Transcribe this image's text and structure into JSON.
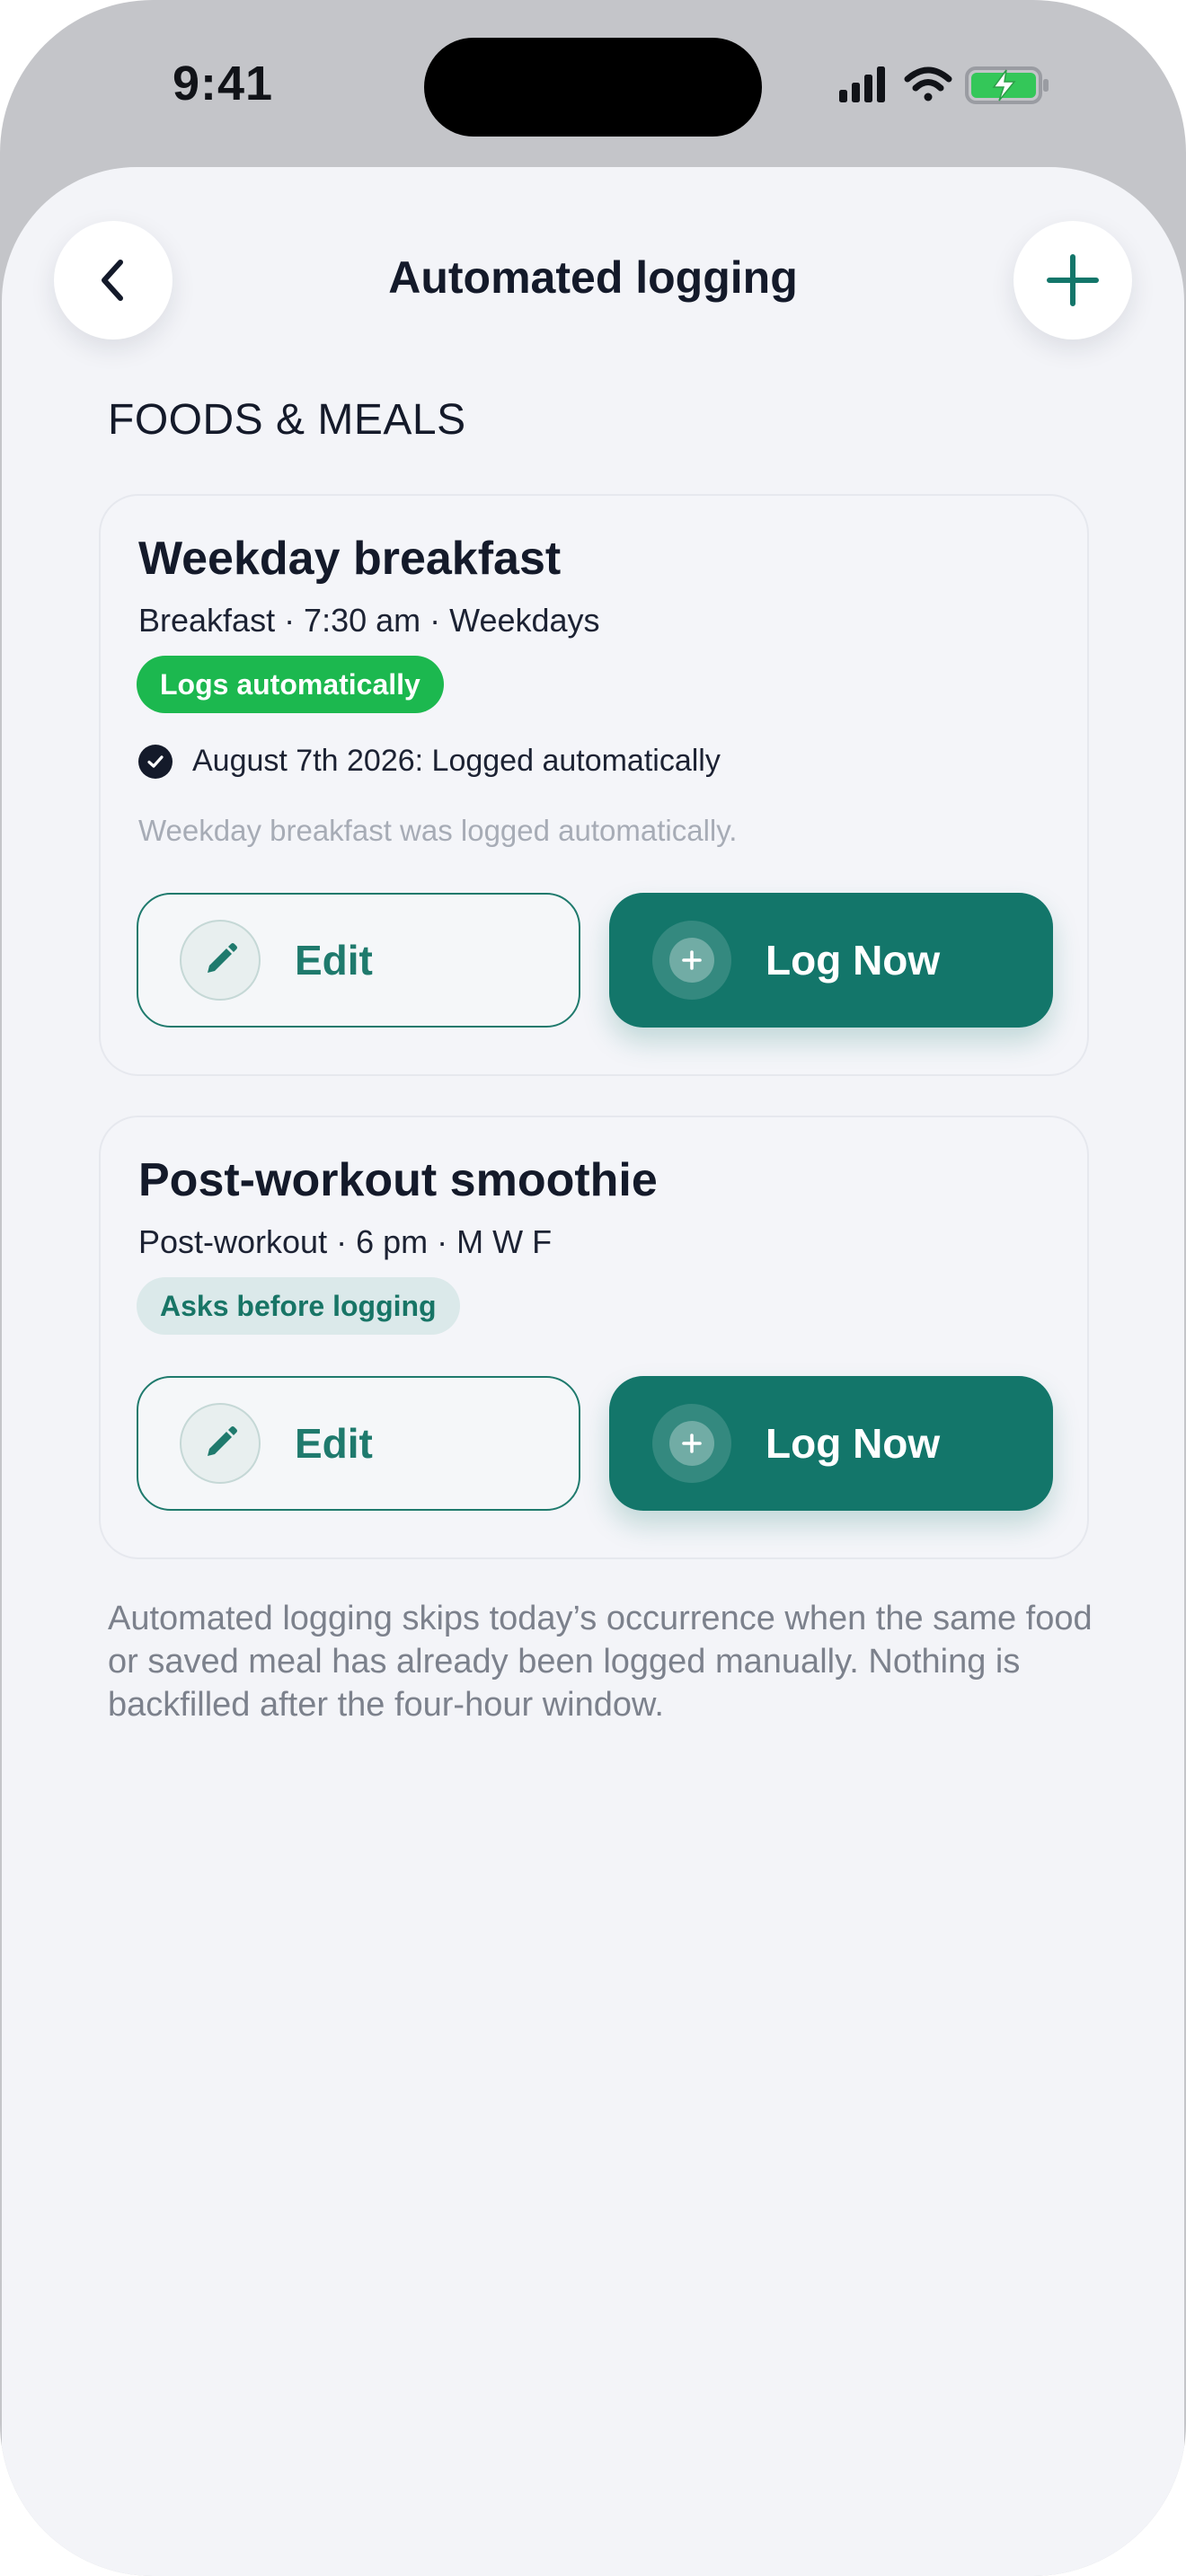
{
  "status_bar": {
    "time": "9:41"
  },
  "nav": {
    "title": "Automated logging",
    "back_icon": "chevron-left-icon",
    "add_icon": "plus-icon"
  },
  "section": {
    "header": "FOODS & MEALS"
  },
  "cards": [
    {
      "title": "Weekday breakfast",
      "subtitle": "Breakfast · 7:30 am · Weekdays",
      "badge": "Logs automatically",
      "log_entry": "August 7th 2026: Logged automatically",
      "log_description": "Weekday breakfast was logged automatically.",
      "edit_label": "Edit",
      "log_now_label": "Log Now"
    },
    {
      "title": "Post-workout smoothie",
      "subtitle": "Post-workout · 6 pm · M W F",
      "badge": "Asks before logging",
      "edit_label": "Edit",
      "log_now_label": "Log Now"
    }
  ],
  "footnote": "Automated logging skips today’s occurrence when the same food or saved meal has already been logged manually. Nothing is backfilled after the four-hour window.",
  "colors": {
    "accent": "#13766a",
    "badge_auto": "#1cb84f",
    "badge_ask_bg": "#dbe9ea",
    "background": "#f3f4f8",
    "battery_green": "#34c759"
  }
}
